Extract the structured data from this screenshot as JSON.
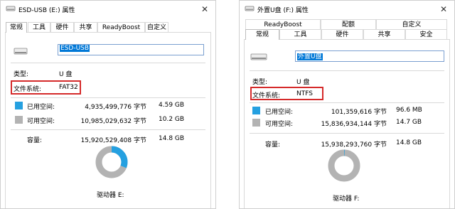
{
  "left": {
    "title": "ESD-USB (E:) 属性",
    "close": "✕",
    "tabs": [
      "常规",
      "工具",
      "硬件",
      "共享",
      "ReadyBoost",
      "自定义"
    ],
    "name": "ESD-USB",
    "type_label": "类型:",
    "type_value": "U 盘",
    "fs_label": "文件系统:",
    "fs_value": "FAT32",
    "used_label": "已用空间:",
    "used_bytes": "4,935,499,776 字节",
    "used_size": "4.59 GB",
    "free_label": "可用空间:",
    "free_bytes": "10,985,029,632 字节",
    "free_size": "10.2 GB",
    "cap_label": "容量:",
    "cap_bytes": "15,920,529,408 字节",
    "cap_size": "14.8 GB",
    "drive_label": "驱动器 E:",
    "used_fraction": 0.31
  },
  "right": {
    "title": "外置U盘 (F:) 属性",
    "close": "✕",
    "tabs_top": [
      "ReadyBoost",
      "配额",
      "自定义"
    ],
    "tabs_bottom": [
      "常规",
      "工具",
      "硬件",
      "共享",
      "安全"
    ],
    "name": "外置U盘",
    "type_label": "类型:",
    "type_value": "U 盘",
    "fs_label": "文件系统:",
    "fs_value": "NTFS",
    "used_label": "已用空间:",
    "used_bytes": "101,359,616 字节",
    "used_size": "96.6 MB",
    "free_label": "可用空间:",
    "free_bytes": "15,836,934,144 字节",
    "free_size": "14.7 GB",
    "cap_label": "容量:",
    "cap_bytes": "15,938,293,760 字节",
    "cap_size": "14.8 GB",
    "drive_label": "驱动器 F:",
    "used_fraction": 0.006
  },
  "colors": {
    "used": "#25a0e0",
    "free": "#b3b3b3",
    "highlight": "#d52a2a"
  }
}
